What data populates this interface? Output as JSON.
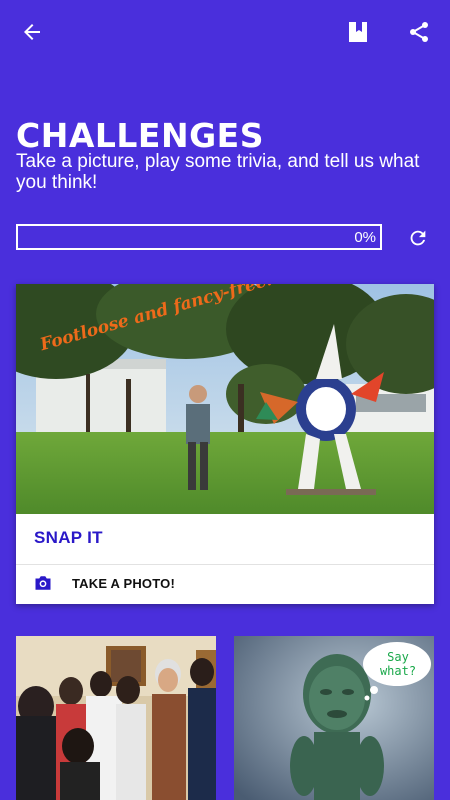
{
  "header": {
    "back_icon": "arrow-left-icon",
    "bookmark_icon": "bookmark-icon",
    "share_icon": "share-icon"
  },
  "page": {
    "title": "CHALLENGES",
    "subtitle": "Take a picture, play some trivia, and tell us what you think!"
  },
  "progress": {
    "value": 0,
    "label": "0%",
    "refresh_icon": "refresh-icon"
  },
  "card": {
    "image_caption": "Footloose and fancy-free!",
    "title": "SNAP IT",
    "action_label": "TAKE A PHOTO!",
    "action_icon": "camera-icon"
  },
  "tiles": [
    {
      "name": "group-museum-tour"
    },
    {
      "name": "jade-statue",
      "speech_bubble": "Say what?"
    }
  ],
  "colors": {
    "background": "#4a2fdc",
    "accent": "#2a18c8",
    "white": "#ffffff"
  }
}
